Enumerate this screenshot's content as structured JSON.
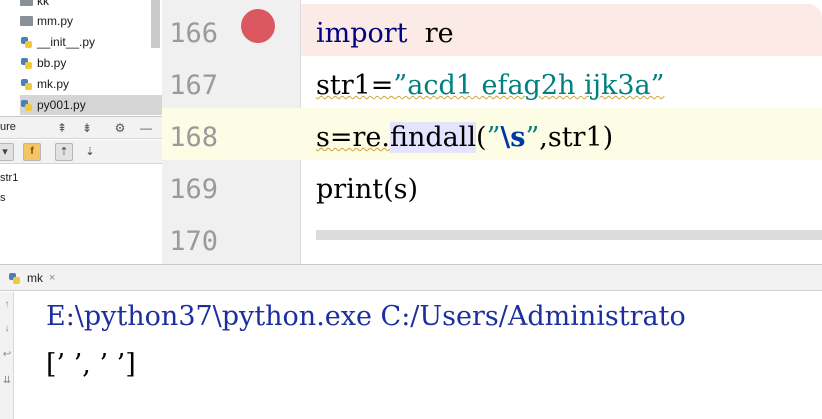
{
  "project_tree": {
    "items": [
      {
        "label": "kk",
        "icon": "folder-icon"
      },
      {
        "label": "mm.py",
        "icon": "folder-icon"
      },
      {
        "label": "__init__.py",
        "icon": "python-file-icon"
      },
      {
        "label": "bb.py",
        "icon": "python-file-icon"
      },
      {
        "label": "mk.py",
        "icon": "python-file-icon"
      },
      {
        "label": "py001.py",
        "icon": "python-file-icon"
      }
    ]
  },
  "structure": {
    "title": "ure",
    "toolbar_f": "f",
    "items": [
      "str1",
      "s"
    ]
  },
  "editor": {
    "lines": [
      {
        "number": "166",
        "parts": [
          "import",
          "  re"
        ],
        "breakpoint": true
      },
      {
        "number": "167",
        "parts": [
          "str1=",
          "”acd1 efag2h ijk3a”"
        ]
      },
      {
        "number": "168",
        "parts": [
          "s=re.",
          "findall",
          "(",
          "”",
          "\\s",
          "”",
          ",str1)"
        ]
      },
      {
        "number": "169",
        "parts": [
          "print(s)"
        ]
      },
      {
        "number": "170"
      }
    ],
    "colors": {
      "keyword": "#000080",
      "string": "#008080",
      "breakpoint": "#db5860",
      "breakpoint_line": "#fbeae6",
      "current_line": "#fdfce4"
    }
  },
  "run": {
    "tab_label": "mk",
    "tab_close": "×",
    "console": {
      "command": "E:\\python37\\python.exe C:/Users/Administrato",
      "output": "[’ ’, ’ ’]"
    }
  }
}
